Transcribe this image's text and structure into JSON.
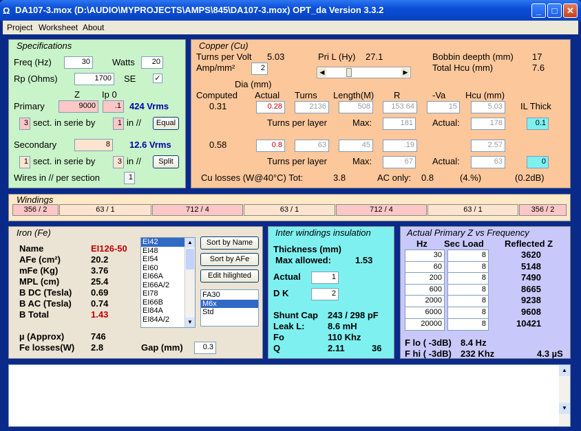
{
  "window": {
    "title": "DA107-3.mox  (D:\\AUDIO\\MYPROJECTS\\AMPS\\845\\DA107-3.mox)  OPT_da Version 3.3.2",
    "icon": "Ω"
  },
  "menu": [
    "Project",
    "Worksheet",
    "About"
  ],
  "spec": {
    "title": "Specifications",
    "freq_label": "Freq (Hz)",
    "freq": "30",
    "watts_label": "Watts",
    "watts": "20",
    "rp_label": "Rp (Ohms)",
    "rp": "1700",
    "se_label": "SE",
    "se_check": "✓",
    "z_label": "Z",
    "ip0_label": "Ip 0",
    "primary_label": "Primary",
    "primary_z": "9000",
    "primary_ip0": ".1",
    "primary_vrms": "424 Vrms",
    "sect_label": "sect. in serie by",
    "in_label": "in //",
    "p_sect": "3",
    "p_par": "1",
    "equal_btn": "Equal",
    "secondary_label": "Secondary",
    "secondary_z": "8",
    "secondary_vrms": "12.6 Vrms",
    "s_sect": "1",
    "s_par": "3",
    "split_btn": "Split",
    "wires_label": "Wires in // per section",
    "wires": "1"
  },
  "copper": {
    "title": "Copper (Cu)",
    "tpv_label": "Turns per Volt",
    "tpv": "5.03",
    "pril_label": "Pri L (Hy)",
    "pril": "27.1",
    "bobbin_label": "Bobbin deepth (mm)",
    "bobbin": "17",
    "amp_label": "Amp/mm²",
    "amp": "2",
    "hcu_total_label": "Total Hcu (mm)",
    "hcu_total": "7.6",
    "dia_label": "Dia (mm)",
    "computed_label": "Computed",
    "actual_label": "Actual",
    "turns_label": "Turns",
    "length_label": "Length(M)",
    "r_label": "R",
    "va_label": "-Va",
    "hcu_label": "Hcu (mm)",
    "ilthick_label": "IL Thick",
    "p_computed": "0.31",
    "p_actual": "0.28",
    "p_turns": "2136",
    "p_length": "508",
    "p_r": "153.64",
    "p_va": "15",
    "p_hcu": "5.03",
    "p_il": "0.1",
    "tpl_label": "Turns per layer",
    "max_label": "Max:",
    "actual2_label": "Actual:",
    "p_max": "181",
    "p_act": "178",
    "s_computed": "0.58",
    "s_actual": "0.8",
    "s_turns": "63",
    "s_length": "45",
    "s_r": ".19",
    "s_hcu": "2.57",
    "s_max": "67",
    "s_act": "63",
    "s_il": "0",
    "losses_label": "Cu losses (W@40°C) Tot:",
    "losses_tot": "3.8",
    "ac_label": "AC only:",
    "ac": "0.8",
    "ac_pct": "(4.%)",
    "ac_db": "(0.2dB)"
  },
  "windings": {
    "title": "Windings",
    "cells": [
      "356 / 2",
      "63 / 1",
      "712 / 4",
      "63 / 1",
      "712 / 4",
      "63 / 1",
      "356 / 2"
    ]
  },
  "iron": {
    "title": "Iron (Fe)",
    "rows": [
      [
        "Name",
        "EI126-50"
      ],
      [
        "AFe (cm²)",
        "20.2"
      ],
      [
        "mFe (Kg)",
        "3.76"
      ],
      [
        "MPL (cm)",
        "25.4"
      ],
      [
        "B DC (Tesla)",
        "0.69"
      ],
      [
        "B AC (Tesla)",
        "0.74"
      ],
      [
        "B Total",
        "1.43"
      ]
    ],
    "mu_label": "µ (Approx)",
    "mu": "746",
    "fe_label": "Fe losses(W)",
    "fe": "2.8",
    "gap_label": "Gap (mm)",
    "gap": "0.3",
    "cores": [
      "EI42",
      "EI48",
      "EI54",
      "EI60",
      "EI66A",
      "EI66A/2",
      "EI78",
      "EI66B",
      "EI84A",
      "EI84A/2"
    ],
    "sort_name": "Sort by Name",
    "sort_afe": "Sort by AFe",
    "edit_btn": "Edit hilighted",
    "types": [
      "FA30",
      "M6x",
      "Std"
    ]
  },
  "inter": {
    "title": "Inter windings insulation",
    "thick_label": "Thickness (mm)",
    "max_label": "Max allowed:",
    "max": "1.53",
    "actual_label": "Actual",
    "actual": "1",
    "dk_label": "D K",
    "dk": "2",
    "shunt_label": "Shunt Cap",
    "shunt": "243 / 298 pF",
    "leak_label": "Leak L:",
    "leak": "8.6 mH",
    "fo_label": "Fo",
    "fo": "110 Khz",
    "q_label": "Q",
    "q": "2.11",
    "q2": "36"
  },
  "freq": {
    "title": "Actual Primary Z vs Frequency",
    "hz_label": "Hz",
    "sec_label": "Sec Load",
    "refl_label": "Reflected Z",
    "rows": [
      [
        "30",
        "8",
        "3620"
      ],
      [
        "60",
        "8",
        "5148"
      ],
      [
        "200",
        "8",
        "7490"
      ],
      [
        "600",
        "8",
        "8665"
      ],
      [
        "2000",
        "8",
        "9238"
      ],
      [
        "6000",
        "8",
        "9608"
      ],
      [
        "20000",
        "8",
        "10421"
      ]
    ],
    "flo_label": "F lo ( -3dB)",
    "flo": "8.4 Hz",
    "fhi_label": "F hi ( -3dB)",
    "fhi": "232 Khz",
    "rise": "4.3 µS"
  }
}
